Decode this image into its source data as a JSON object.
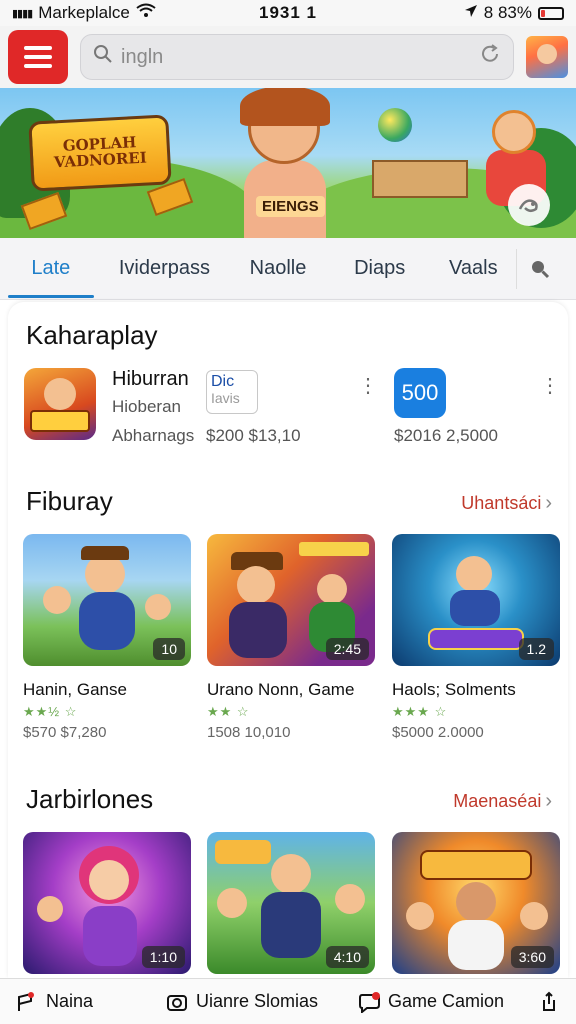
{
  "status_bar": {
    "carrier": "Markeplalce",
    "time": "1931 1",
    "battery": "8 83%",
    "battery_level": 0.22
  },
  "header": {
    "search_placeholder": "ingln"
  },
  "banner": {
    "logo_text": "GOPLAH VADNOREI",
    "badge_text": "EIENGS"
  },
  "tabs": [
    "Late",
    "Ividerpass",
    "Naolle",
    "Diaps",
    "Vaals"
  ],
  "featured": {
    "title": "Kaharaplay",
    "item_name": "Hiburran",
    "item_sub": "Hioberan",
    "item_meta": "Abharnags",
    "logo_line1": "Dic",
    "logo_line2": "Iavis",
    "price": "$200 $13,10",
    "tile_text": "500",
    "tile_meta": "$2016 2,5000"
  },
  "section1": {
    "title": "Fiburay",
    "see_all": "Uhantsáci",
    "cards": [
      {
        "title": "Hanin, Ganse",
        "count": "10",
        "stars": "★★½ ☆",
        "prices": "$570  $7,280"
      },
      {
        "title": "Urano Nonn, Game",
        "count": "2:45",
        "stars": "★★ ☆",
        "prices": "1508  10,010"
      },
      {
        "title": "Haols; Solments",
        "count": "1.2",
        "stars": "★★★ ☆",
        "prices": "$5000  2.0000"
      }
    ]
  },
  "section2": {
    "title": "Jarbirlones",
    "see_all": "Maenaséai",
    "cards": [
      {
        "count": "1:10"
      },
      {
        "count": "4:10"
      },
      {
        "count": "3:60"
      }
    ]
  },
  "bottom_nav": {
    "item1": "Naina",
    "item2": "Uianre Slomias",
    "item3": "Game Camion"
  }
}
